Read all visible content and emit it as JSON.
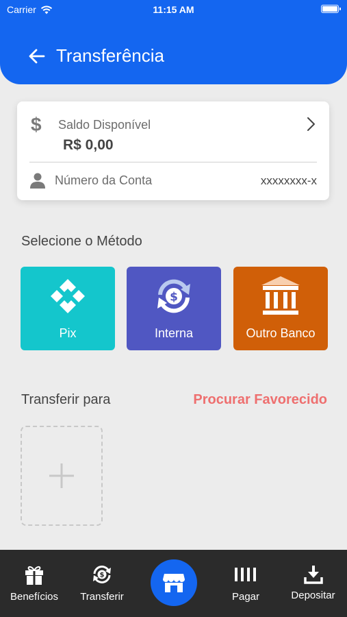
{
  "status_bar": {
    "carrier": "Carrier",
    "time": "11:15 AM"
  },
  "header": {
    "title": "Transferência",
    "back_icon": "arrow-left-icon"
  },
  "balance_card": {
    "saldo_label": "Saldo Disponível",
    "saldo_value": "R$ 0,00",
    "conta_label": "Número da Conta",
    "conta_value": "xxxxxxxx-x"
  },
  "methods": {
    "title": "Selecione o Método",
    "items": [
      {
        "label": "Pix",
        "icon": "pix-icon",
        "color": "#14c6cc"
      },
      {
        "label": "Interna",
        "icon": "internal-transfer-icon",
        "color": "#5057c2"
      },
      {
        "label": "Outro Banco",
        "icon": "bank-icon",
        "color": "#d05f08"
      }
    ]
  },
  "transfer_to": {
    "label": "Transferir para",
    "search_link": "Procurar Favorecido"
  },
  "tabbar": {
    "items": [
      {
        "label": "Benefícios",
        "icon": "gift-icon"
      },
      {
        "label": "Transferir",
        "icon": "transfer-icon"
      },
      {
        "label": "",
        "icon": "store-icon"
      },
      {
        "label": "Pagar",
        "icon": "barcode-icon"
      },
      {
        "label": "Depositar",
        "icon": "download-icon"
      }
    ]
  },
  "colors": {
    "primary": "#1466f0",
    "accent_link": "#ee6f6f",
    "tabbar_bg": "#2b2b2b",
    "page_bg": "#ececec"
  }
}
